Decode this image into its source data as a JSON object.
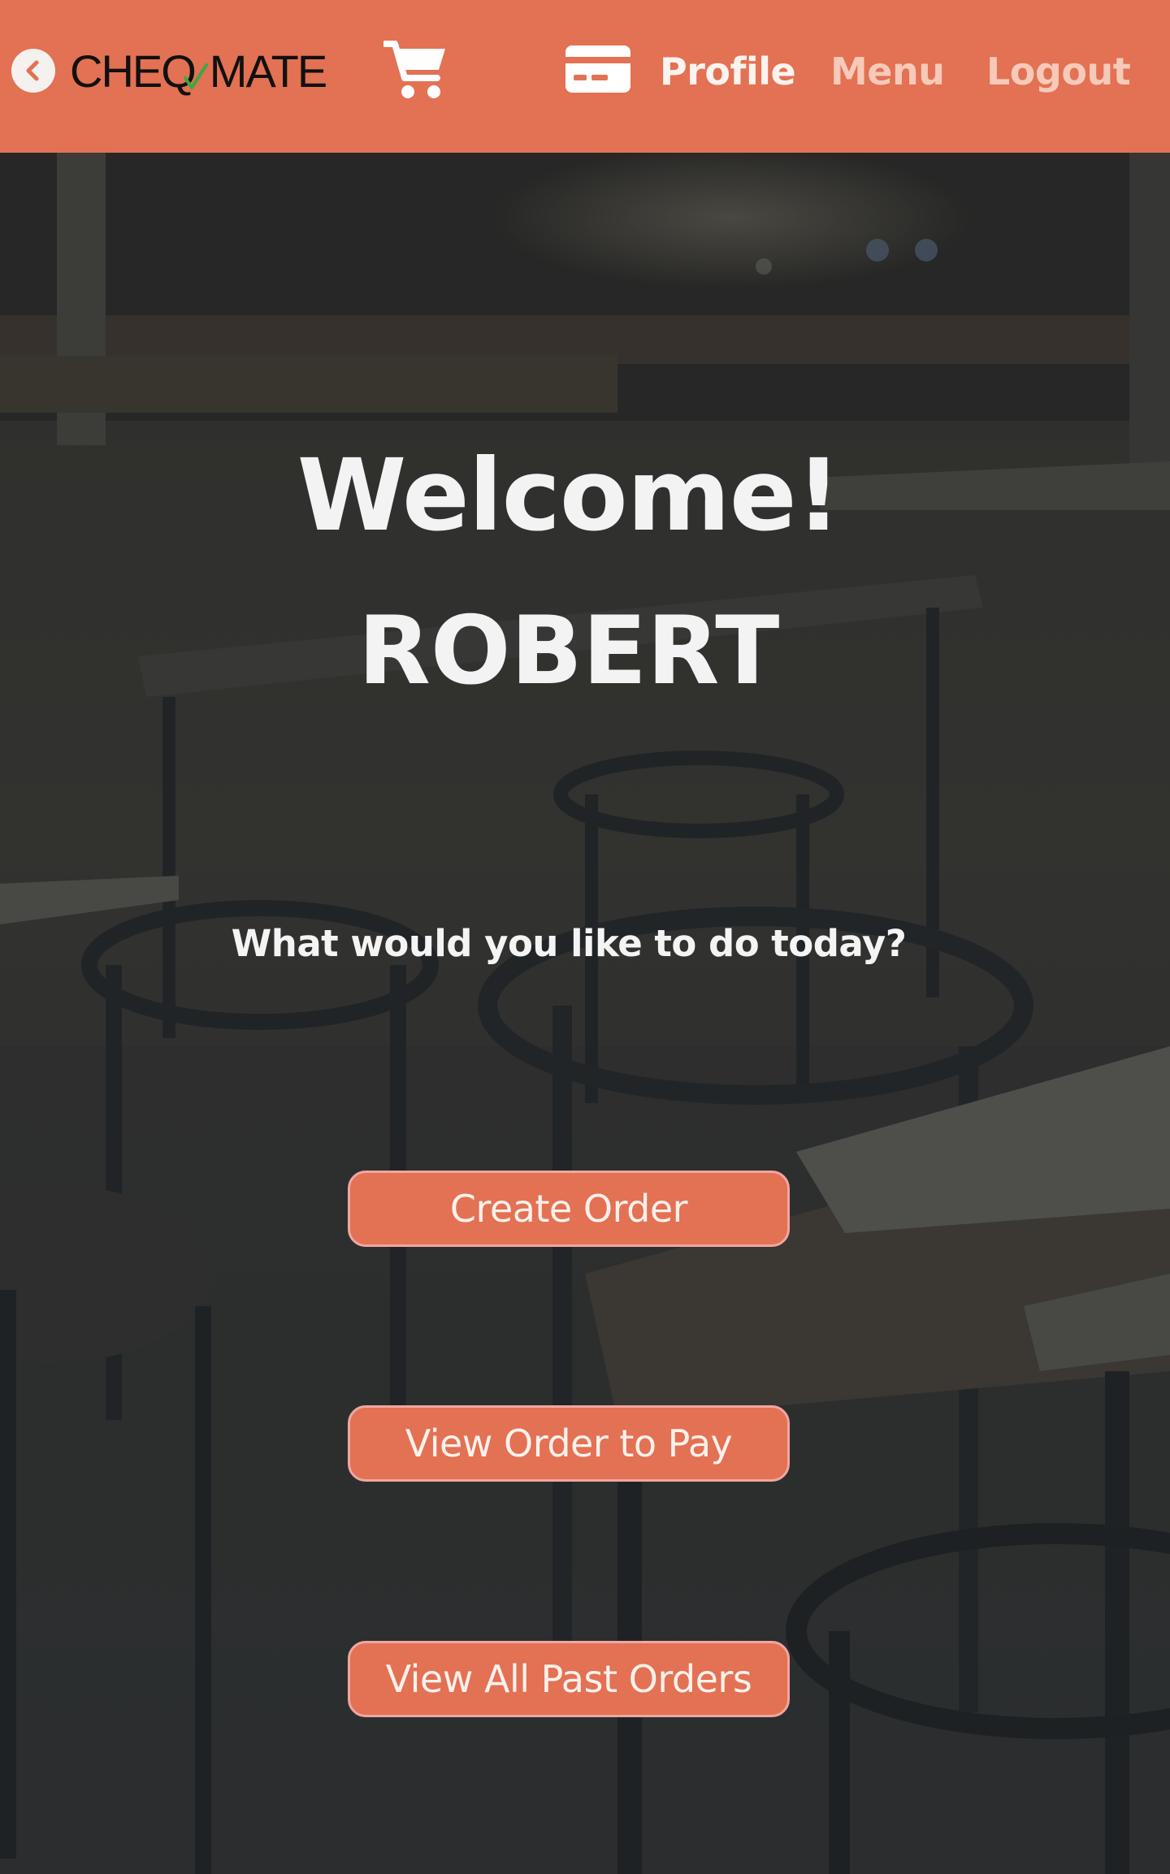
{
  "navbar": {
    "brand": {
      "part1": "CHE",
      "part2": "Q",
      "part3": "MATE"
    },
    "icons": {
      "back": "chevron-left-circle-icon",
      "cart": "shopping-cart-icon",
      "card": "credit-card-icon"
    },
    "links": {
      "profile": "Profile",
      "menu": "Menu",
      "logout": "Logout"
    }
  },
  "hero": {
    "welcome": "Welcome!",
    "username": "ROBERT",
    "prompt": "What would you like to do today?"
  },
  "actions": {
    "create_order": "Create Order",
    "view_order_to_pay": "View Order to Pay",
    "view_past_orders": "View All Past Orders"
  },
  "colors": {
    "accent": "#e37153",
    "nav_active_text": "#fbf3ef",
    "nav_inactive_text": "#f6c9b9",
    "button_border": "#f0a6a0",
    "check_green": "#3aa845"
  }
}
